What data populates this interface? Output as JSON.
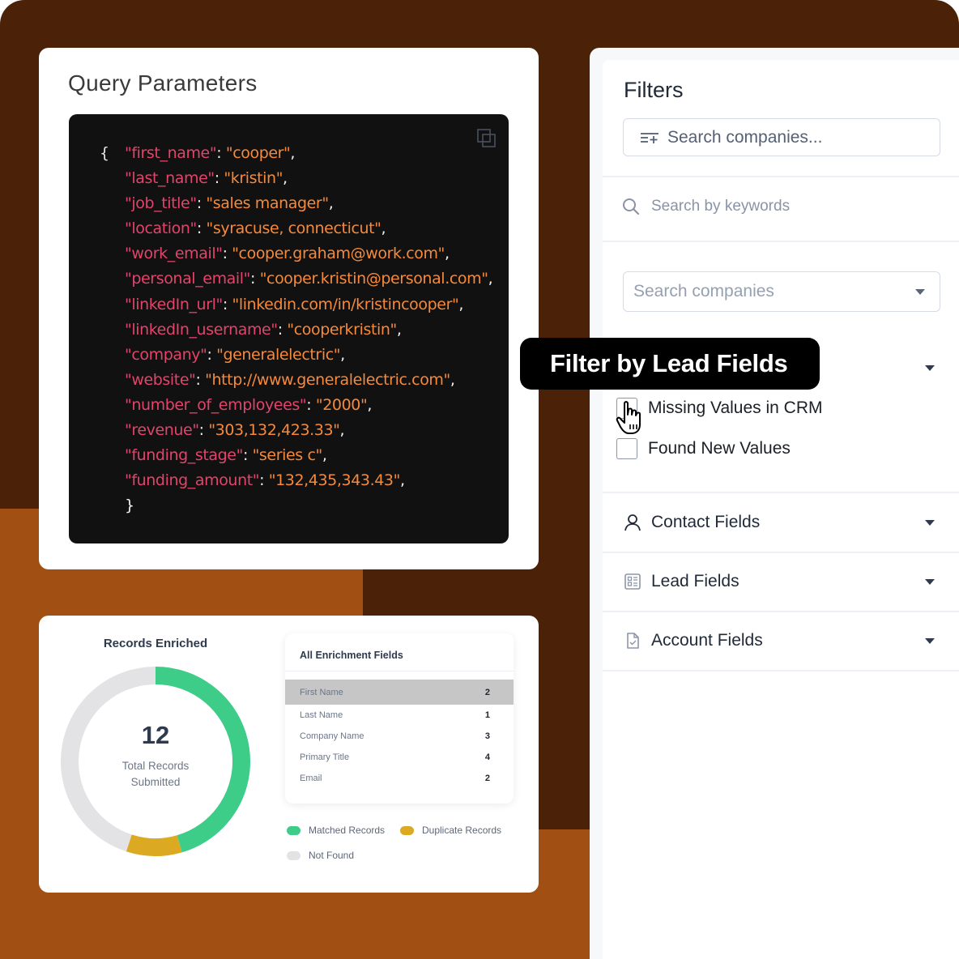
{
  "query_parameters": {
    "title": "Query Parameters",
    "open_brace": "{",
    "close_brace": "}",
    "lines": [
      {
        "key": "\"first_name\"",
        "value": "\"cooper\""
      },
      {
        "key": "\"last_name\"",
        "value": "\"kristin\""
      },
      {
        "key": "\"job_title\"",
        "value": "\"sales manager\""
      },
      {
        "key": "\"location\"",
        "value": "\"syracuse, connecticut\""
      },
      {
        "key": "\"work_email\"",
        "value": "\"cooper.graham@work.com\""
      },
      {
        "key": "\"personal_email\"",
        "value": "\"cooper.kristin@personal.com\""
      },
      {
        "key": "\"linkedIn_url\"",
        "value": "\"linkedin.com/in/kristincooper\""
      },
      {
        "key": "\"linkedIn_username\"",
        "value": "\"cooperkristin\""
      },
      {
        "key": "\"company\"",
        "value": "\"generalelectric\""
      },
      {
        "key": "\"website\"",
        "value": "\"http://www.generalelectric.com\""
      },
      {
        "key": "\"number_of_employees\"",
        "value": "\"2000\""
      },
      {
        "key": "\"revenue\"",
        "value": "\"303,132,423.33\""
      },
      {
        "key": "\"funding_stage\"",
        "value": "\"series c\""
      },
      {
        "key": "\"funding_amount\"",
        "value": "\"132,435,343.43\""
      }
    ],
    "copy_icon": "copy-icon"
  },
  "records_enriched": {
    "title": "Records Enriched",
    "total": "12",
    "caption_line1": "Total Records",
    "caption_line2": "Submitted",
    "segments": [
      {
        "name": "Matched Records",
        "share": 0.455,
        "color": "#3ecd88"
      },
      {
        "name": "Duplicate Records",
        "share": 0.095,
        "color": "#dca923"
      },
      {
        "name": "Not Found",
        "share": 0.45,
        "color": "#e3e3e6"
      }
    ],
    "legend": [
      "Matched Records",
      "Duplicate Records",
      "Not Found"
    ]
  },
  "enrichment_fields": {
    "title": "All Enrichment Fields",
    "rows": [
      {
        "label": "First Name",
        "count": "2"
      },
      {
        "label": "Last Name",
        "count": "1"
      },
      {
        "label": "Company Name",
        "count": "3"
      },
      {
        "label": "Primary Title",
        "count": "4"
      },
      {
        "label": "Email",
        "count": "2"
      }
    ]
  },
  "filters": {
    "title": "Filters",
    "search_companies_placeholder": "Search companies...",
    "keywords_placeholder": "Search by keywords",
    "company_select_placeholder": "Search companies",
    "checkboxes": [
      {
        "label": "Missing Values in CRM",
        "checked": false
      },
      {
        "label": "Found New Values",
        "checked": false
      }
    ],
    "sections": [
      {
        "label": "Contact Fields",
        "icon": "user-icon"
      },
      {
        "label": "Lead Fields",
        "icon": "list-icon"
      },
      {
        "label": "Account Fields",
        "icon": "document-check-icon"
      }
    ]
  },
  "tooltip": {
    "text": "Filter by Lead Fields"
  },
  "colors": {
    "background_dark": "#4b2208",
    "background_orange": "#a24f14",
    "code_key": "#e2446b",
    "code_value": "#f58a3c"
  }
}
